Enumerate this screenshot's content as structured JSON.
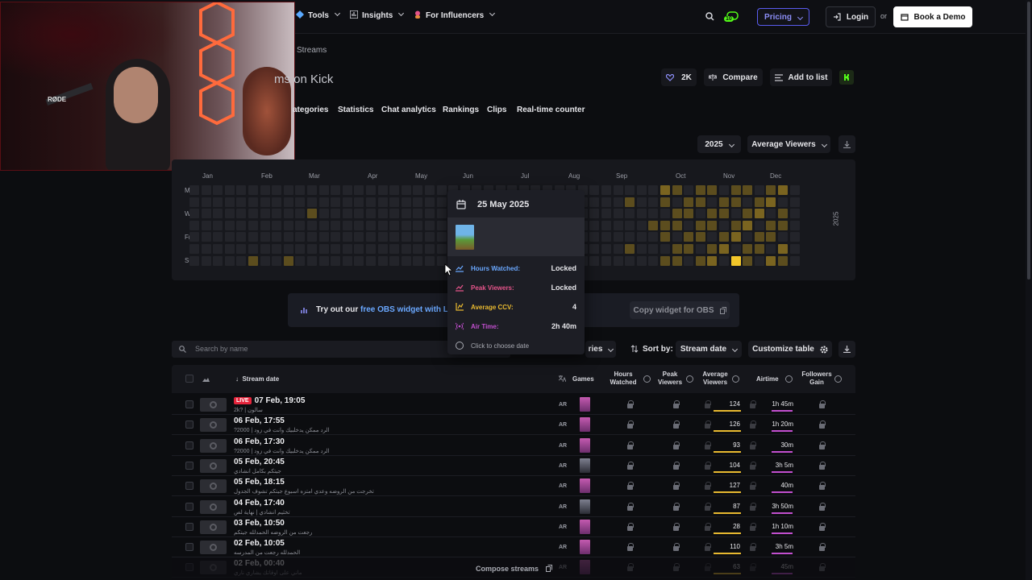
{
  "nav": {
    "tools": "Tools",
    "insights": "Insights",
    "influencers": "For Influencers",
    "pricing": "Pricing",
    "login": "Login",
    "or": "or",
    "demo": "Book a Demo",
    "badge": "10"
  },
  "breadcrumb": "Streams",
  "page_title": "ms on Kick",
  "actions": {
    "likes": "2K",
    "compare": "Compare",
    "add_list": "Add to list"
  },
  "subtabs": [
    "ategories",
    "Statistics",
    "Chat analytics",
    "Rankings",
    "Clips",
    "Real-time counter"
  ],
  "filters": {
    "year": "2025",
    "metric": "Average Viewers"
  },
  "heatmap": {
    "months": [
      "Jan",
      "Feb",
      "Mar",
      "Apr",
      "May",
      "Jun",
      "Jul",
      "Aug",
      "Sep",
      "Oct",
      "Nov",
      "Dec"
    ],
    "days": [
      "Mon",
      "Wed",
      "Fri",
      "Sun"
    ],
    "year_label": "2025"
  },
  "obs": {
    "text_pre": "Try out our ",
    "text_link": "free OBS widget with L",
    "copy": "Copy widget for OBS"
  },
  "search": {
    "placeholder": "Search by name"
  },
  "toolbar": {
    "categories": "ries",
    "sort_label": "Sort by:",
    "sort_value": "Stream date",
    "customize": "Customize table"
  },
  "table": {
    "headers": {
      "stream_date": "Stream date",
      "games": "Games",
      "hours_watched": "Hours Watched",
      "peak_viewers": "Peak Viewers",
      "avg_viewers": "Average Viewers",
      "airtime": "Airtime",
      "followers": "Followers Gain"
    },
    "rows": [
      {
        "date": "07 Feb, 19:05",
        "live": "LIVE",
        "title": "2k? | سالون",
        "lang": "AR",
        "avg": "124",
        "air": "1h 45m"
      },
      {
        "date": "06 Feb, 17:55",
        "title": "الرد ممكن يدخلبيك وانت في زود | 2000?",
        "lang": "AR",
        "avg": "126",
        "air": "1h 20m"
      },
      {
        "date": "06 Feb, 17:30",
        "title": "الرد ممكن يدخلبيك وانت في زود | 2000?",
        "lang": "AR",
        "avg": "93",
        "air": "30m"
      },
      {
        "date": "05 Feb, 20:45",
        "title": "جيتكم بكامل انشادي",
        "lang": "AR",
        "avg": "104",
        "air": "3h 5m"
      },
      {
        "date": "05 Feb, 18:15",
        "title": "تخرجت من الروضه وعدي امتزه اسبوع جيتكم تشوف الجدول",
        "lang": "AR",
        "avg": "127",
        "air": "40m"
      },
      {
        "date": "04 Feb, 17:40",
        "title": "تخثيم انشادي | نهاية لص",
        "lang": "AR",
        "avg": "87",
        "air": "3h 50m"
      },
      {
        "date": "03 Feb, 10:50",
        "title": "رجعت من الروضه الحمدلله جيتكم",
        "lang": "AR",
        "avg": "28",
        "air": "1h 10m"
      },
      {
        "date": "02 Feb, 10:05",
        "title": "الحمدلله رجعت من المدرسه",
        "lang": "AR",
        "avg": "110",
        "air": "3h 5m"
      },
      {
        "date": "02 Feb, 00:40",
        "title": "ماني على اوقاتك يشاري ناري",
        "lang": "AR",
        "avg": "63",
        "air": "45m"
      }
    ],
    "compose": "Compose streams"
  },
  "tooltip": {
    "date": "25 May 2025",
    "hours_label": "Hours Watched:",
    "hours_value": "Locked",
    "peak_label": "Peak Viewers:",
    "peak_value": "Locked",
    "ccv_label": "Average CCV:",
    "ccv_value": "4",
    "air_label": "Air Time:",
    "air_value": "2h 40m",
    "hint": "Click to choose date"
  },
  "webcam": {
    "mic_brand": "RØDE"
  },
  "colors": {
    "accent_yellow": "#e8b930",
    "accent_pink": "#c24fcf",
    "live_red": "#e5243b",
    "kick_green": "#53fc18"
  }
}
